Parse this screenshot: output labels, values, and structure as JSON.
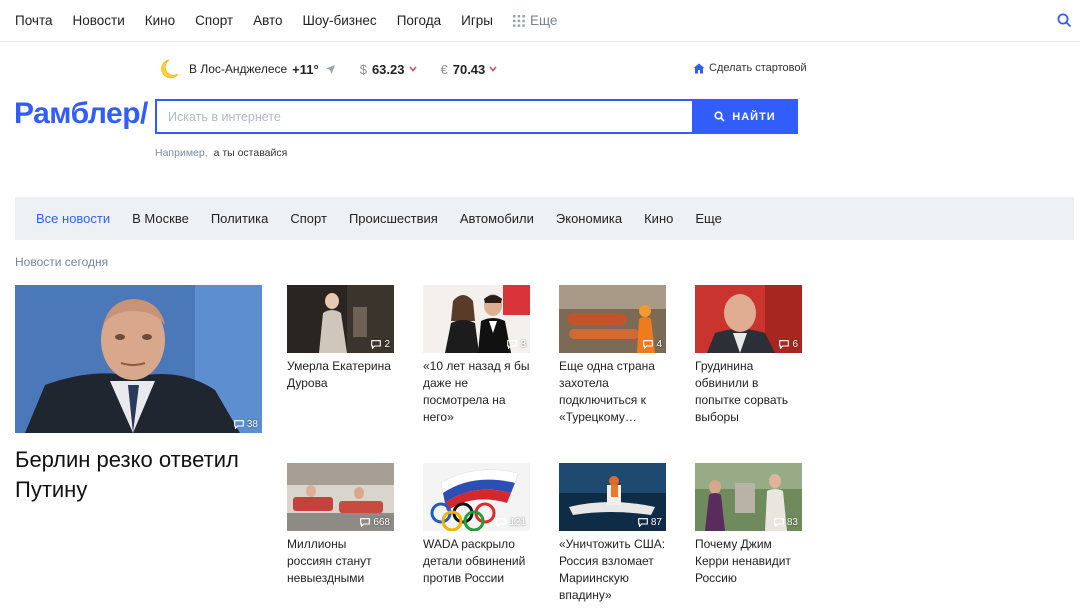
{
  "topnav": {
    "items": [
      "Почта",
      "Новости",
      "Кино",
      "Спорт",
      "Авто",
      "Шоу-бизнес",
      "Погода",
      "Игры"
    ],
    "more_label": "Еще"
  },
  "weather": {
    "city": "В Лос-Анджелесе",
    "temp": "+11°"
  },
  "currency": {
    "usd": {
      "symbol": "$",
      "value": "63.23"
    },
    "eur": {
      "symbol": "€",
      "value": "70.43"
    }
  },
  "startpage_label": "Сделать стартовой",
  "logo": "Рамблер/",
  "search": {
    "placeholder": "Искать в интернете",
    "button_label": "НАЙТИ"
  },
  "example": {
    "label": "Например,",
    "text": "а ты оставайся"
  },
  "categories": [
    "Все новости",
    "В Москве",
    "Политика",
    "Спорт",
    "Происшествия",
    "Автомобили",
    "Экономика",
    "Кино",
    "Еще"
  ],
  "section_title": "Новости сегодня",
  "main_news": {
    "title": "Берлин резко ответил Путину",
    "comments": "38"
  },
  "news": [
    {
      "caption": "Умерла Екатерина Дурова",
      "comments": "2"
    },
    {
      "caption": "«10 лет назад я бы даже не посмотрела на него»",
      "comments": "3"
    },
    {
      "caption": "Еще одна страна захотела подключиться к «Турецкому…",
      "comments": "4"
    },
    {
      "caption": "Грудинина обвинили в попытке сорвать выборы",
      "comments": "6"
    },
    {
      "caption": "Миллионы россиян станут невыездными",
      "comments": "668"
    },
    {
      "caption": "WADA раскрыло детали обвинений против России",
      "comments": "121"
    },
    {
      "caption": "«Уничтожить США: Россия взломает Мариинскую впадину»",
      "comments": "87"
    },
    {
      "caption": "Почему Джим Керри ненавидит Россию",
      "comments": "83"
    }
  ],
  "colors": {
    "accent": "#315efb",
    "cat_bar_bg": "#eef1f4",
    "down_arrow": "#e5484d"
  }
}
